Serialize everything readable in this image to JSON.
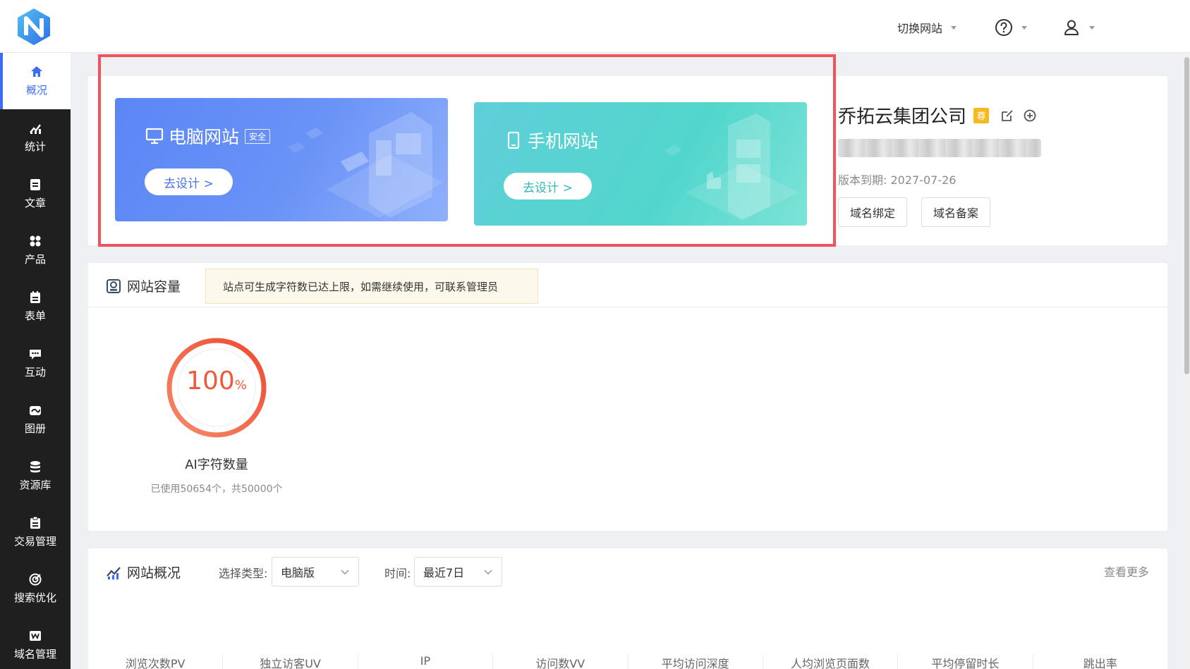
{
  "header": {
    "switch_site": "切换网站",
    "colors": {
      "brand_blue": "#2b6de8",
      "brand_light": "#56c3f2"
    }
  },
  "sidebar": {
    "items": [
      {
        "label": "概况",
        "icon": "home-icon",
        "active": true
      },
      {
        "label": "统计",
        "icon": "chart-icon"
      },
      {
        "label": "文章",
        "icon": "article-icon"
      },
      {
        "label": "产品",
        "icon": "grid-icon"
      },
      {
        "label": "表单",
        "icon": "form-icon"
      },
      {
        "label": "互动",
        "icon": "chat-icon"
      },
      {
        "label": "图册",
        "icon": "album-icon"
      },
      {
        "label": "资源库",
        "icon": "database-icon"
      },
      {
        "label": "交易管理",
        "icon": "trade-icon"
      },
      {
        "label": "搜索优化",
        "icon": "seo-icon"
      },
      {
        "label": "域名管理",
        "icon": "domain-icon"
      }
    ]
  },
  "cards": {
    "pc": {
      "title": "电脑网站",
      "tag": "安全",
      "button": "去设计 >"
    },
    "mobile": {
      "title": "手机网站",
      "button": "去设计 >"
    }
  },
  "company": {
    "name": "乔拓云集团公司",
    "vip_badge": "尊",
    "expiry": "版本到期: 2027-07-26",
    "buttons": [
      "域名绑定",
      "域名备案"
    ]
  },
  "capacity": {
    "title": "网站容量",
    "notice": "站点可生成字符数已达上限，如需继续使用，可联系管理员",
    "percent": "100",
    "percent_unit": "%",
    "label": "AI字符数量",
    "usage": "已使用50654个，共50000个",
    "fill": 1.0
  },
  "overview": {
    "title": "网站概况",
    "type_label": "选择类型:",
    "type_value": "电脑版",
    "time_label": "时间:",
    "time_value": "最近7日",
    "more": "查看更多",
    "columns": [
      "浏览次数PV",
      "独立访客UV",
      "IP",
      "访问数VV",
      "平均访问深度",
      "人均浏览页面数",
      "平均停留时长",
      "跳出率"
    ]
  }
}
